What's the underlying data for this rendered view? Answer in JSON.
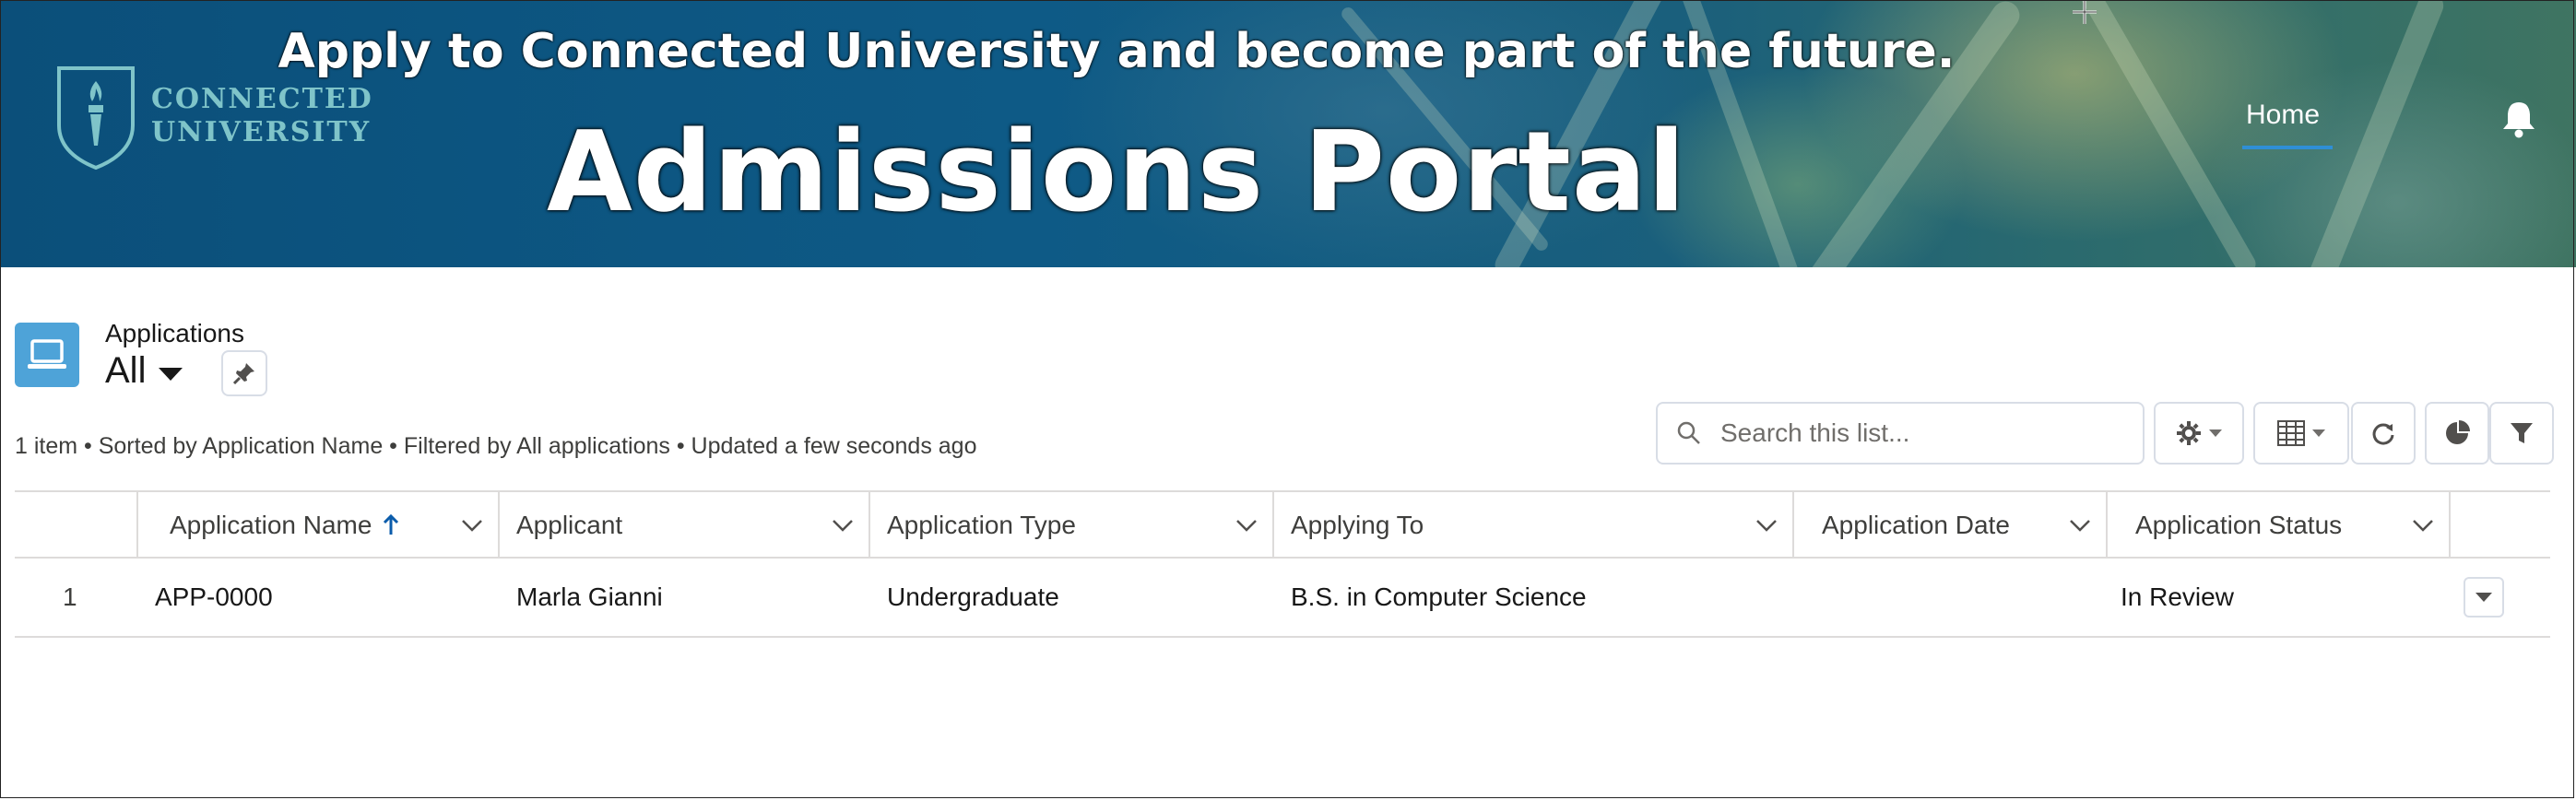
{
  "banner": {
    "logo_line1": "CONNECTED",
    "logo_line2": "UNIVERSITY",
    "tagline": "Apply to Connected University and become part of the future.",
    "title": "Admissions Portal",
    "nav_home": "Home",
    "bell_icon": "bell-icon"
  },
  "list_view": {
    "object_label": "Applications",
    "view_name": "All",
    "info": "1 item • Sorted by Application Name • Filtered by All applications • Updated a few seconds ago",
    "search_placeholder": "Search this list...",
    "toolbar_icons": [
      "gear-icon",
      "table-icon",
      "refresh-icon",
      "chart-icon",
      "filter-icon"
    ]
  },
  "table": {
    "columns": [
      {
        "label": "Application Name",
        "sorted": "ascending"
      },
      {
        "label": "Applicant"
      },
      {
        "label": "Application Type"
      },
      {
        "label": "Applying To"
      },
      {
        "label": "Application Date"
      },
      {
        "label": "Application Status"
      }
    ],
    "rows": [
      {
        "num": "1",
        "name": "APP-0000",
        "applicant": "Marla Gianni",
        "type": "Undergraduate",
        "applying_to": "B.S. in Computer Science",
        "date": "",
        "status": "In Review"
      }
    ]
  },
  "colors": {
    "brand_icon": "#4ea3d8",
    "nav_underline": "#2f8fd6",
    "sort_arrow": "#0b5cab"
  }
}
